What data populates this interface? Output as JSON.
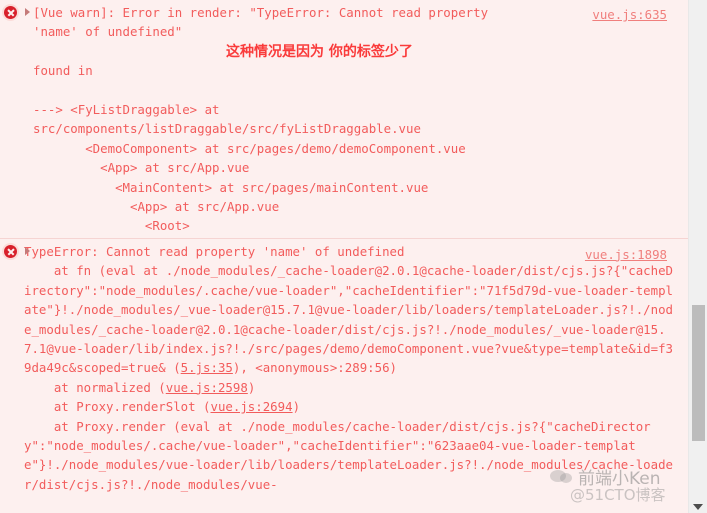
{
  "console": {
    "background": "#fdf0ef",
    "text_color": "#f25c5c",
    "badge_color": "#d8202b",
    "errors": [
      {
        "icon": "error-circle-icon",
        "source_link": "vue.js:635",
        "message": "[Vue warn]: Error in render: \"TypeError: Cannot read property\n'name' of undefined\"\n\nfound in\n\n---> <FyListDraggable> at\nsrc/components/listDraggable/src/fyListDraggable.vue\n       <DemoComponent> at src/pages/demo/demoComponent.vue\n         <App> at src/App.vue\n           <MainContent> at src/pages/mainContent.vue\n             <App> at src/App.vue\n               <Root>"
      },
      {
        "icon": "error-circle-icon",
        "source_link": "vue.js:1898",
        "message_head": "TypeError: Cannot read property 'name' of undefined\n    at fn (eval at ./node_modules/_cache-loader@2.0.1@cache-loader/dist/cjs.js?{\"cacheDirectory\":\"node_modules/.cache/vue-loader\",\"cacheIdentifier\":\"71f5d79d-vue-loader-template\"}!./node_modules/_vue-loader@15.7.1@vue-loader/lib/loaders/templateLoader.js?!./node_modules/_cache-loader@2.0.1@cache-loader/dist/cjs.js?!./node_modules/_vue-loader@15.7.1@vue-loader/lib/index.js?!./src/pages/demo/demoComponent.vue?vue&type=template&id=f39da49c&scoped=true& (",
        "link_1": "5.js:35",
        "message_mid": "), <anonymous>:289:56)\n    at normalized (",
        "link_2": "vue.js:2598",
        "message_mid2": ")\n    at Proxy.renderSlot (",
        "link_3": "vue.js:2694",
        "message_tail": ")\n    at Proxy.render (eval at ./node_modules/cache-loader/dist/cjs.js?{\"cacheDirectory\":\"node_modules/.cache/vue-loader\",\"cacheIdentifier\":\"623aae04-vue-loader-template\"}!./node_modules/vue-loader/lib/loaders/templateLoader.js?!./node_modules/cache-loader/dist/cjs.js?!./node_modules/vue-"
      }
    ]
  },
  "annotation": {
    "text": "这种情况是因为 你的标签少了",
    "color": "#fa3b3b"
  },
  "scrollbar": {
    "down_arrow": "chevron-down-icon"
  },
  "watermark": {
    "primary": "前端小Ken",
    "secondary": "@51CTO博客"
  }
}
